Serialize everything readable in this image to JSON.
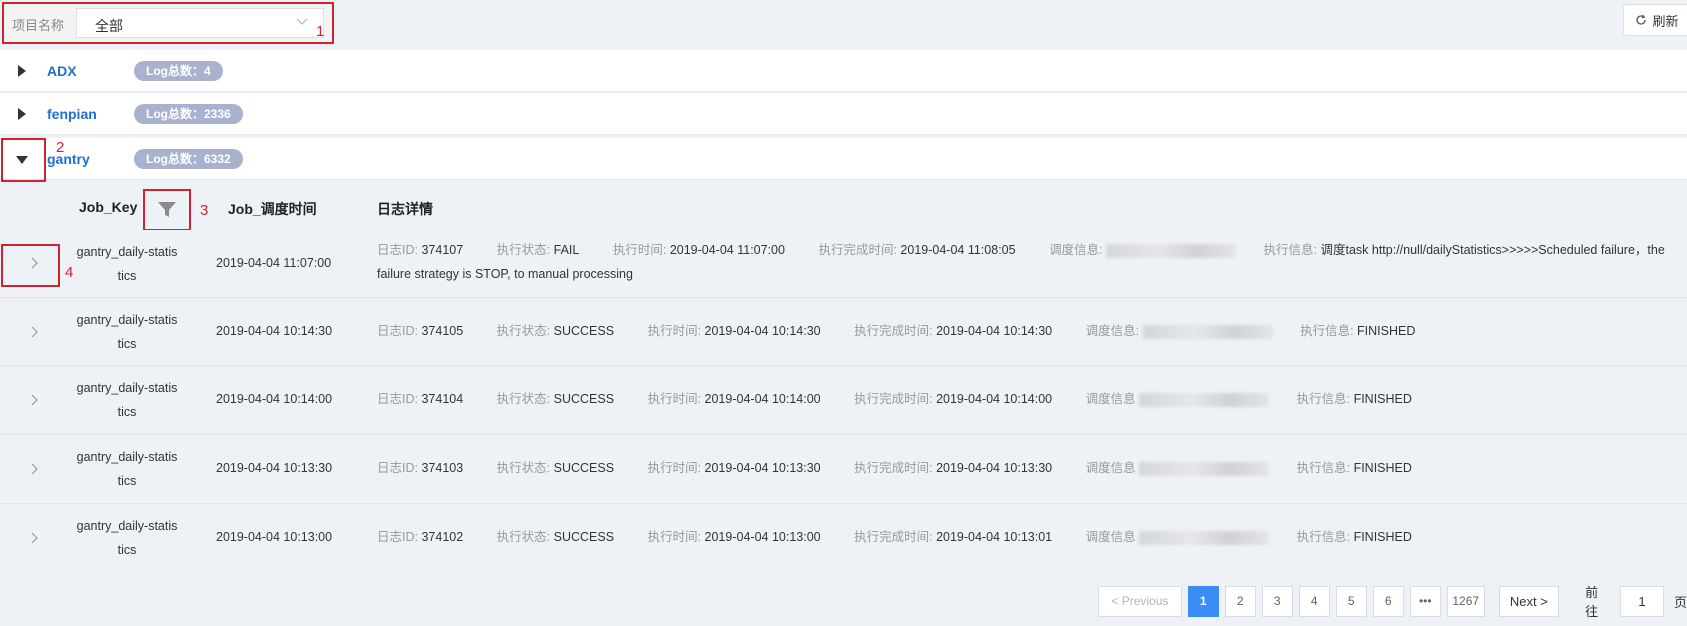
{
  "filter": {
    "label": "项目名称",
    "value": "全部"
  },
  "annotations": [
    "1",
    "2",
    "3",
    "4"
  ],
  "toolbar": {
    "refresh_label": "刷新"
  },
  "groups": [
    {
      "name": "ADX",
      "badge": "Log总数：4"
    },
    {
      "name": "fenpian",
      "badge": "Log总数：2336"
    },
    {
      "name": "gantry",
      "badge": "Log总数：6332"
    }
  ],
  "table": {
    "headers": [
      "Job_Key",
      "Job_调度时间",
      "日志详情"
    ],
    "labels": {
      "log_id": "日志ID:",
      "status": "执行状态:",
      "exec_time": "执行时间:",
      "finish_time": "执行完成时间:",
      "schedule": "调度信息:",
      "schedule_alt": "调度信息",
      "exec_info": "执行信息:"
    },
    "rows": [
      {
        "job_key_1": "gantry_daily-statis",
        "job_key_2": "tics",
        "time": "2019-04-04 11:07:00",
        "log_id": "374107",
        "status": "FAIL",
        "exec_time": "2019-04-04 11:07:00",
        "finish_time": "2019-04-04 11:08:05",
        "exec_info": "调度task http://null/dailyStatistics>>>>>Scheduled failure，the failure strategy is STOP, to manual processing"
      },
      {
        "job_key_1": "gantry_daily-statis",
        "job_key_2": "tics",
        "time": "2019-04-04 10:14:30",
        "log_id": "374105",
        "status": "SUCCESS",
        "exec_time": "2019-04-04 10:14:30",
        "finish_time": "2019-04-04 10:14:30",
        "exec_info": "FINISHED"
      },
      {
        "job_key_1": "gantry_daily-statis",
        "job_key_2": "tics",
        "time": "2019-04-04 10:14:00",
        "log_id": "374104",
        "status": "SUCCESS",
        "exec_time": "2019-04-04 10:14:00",
        "finish_time": "2019-04-04 10:14:00",
        "exec_info": "FINISHED"
      },
      {
        "job_key_1": "gantry_daily-statis",
        "job_key_2": "tics",
        "time": "2019-04-04 10:13:30",
        "log_id": "374103",
        "status": "SUCCESS",
        "exec_time": "2019-04-04 10:13:30",
        "finish_time": "2019-04-04 10:13:30",
        "exec_info": "FINISHED"
      },
      {
        "job_key_1": "gantry_daily-statis",
        "job_key_2": "tics",
        "time": "2019-04-04 10:13:00",
        "log_id": "374102",
        "status": "SUCCESS",
        "exec_time": "2019-04-04 10:13:00",
        "finish_time": "2019-04-04 10:13:01",
        "exec_info": "FINISHED"
      }
    ]
  },
  "pagination": {
    "prev_label": "< Previous",
    "pages": [
      "1",
      "2",
      "3",
      "4",
      "5",
      "6"
    ],
    "ellipsis": "•••",
    "last_page": "1267",
    "next_label": "Next >",
    "goto_label": "前往",
    "goto_value": "1",
    "page_suffix": "页",
    "current_page": 1
  },
  "colors": {
    "accent": "#3c8cf5",
    "link": "#1d6fd1",
    "annotation": "#d0232f",
    "badge": "#a8b2cf"
  }
}
